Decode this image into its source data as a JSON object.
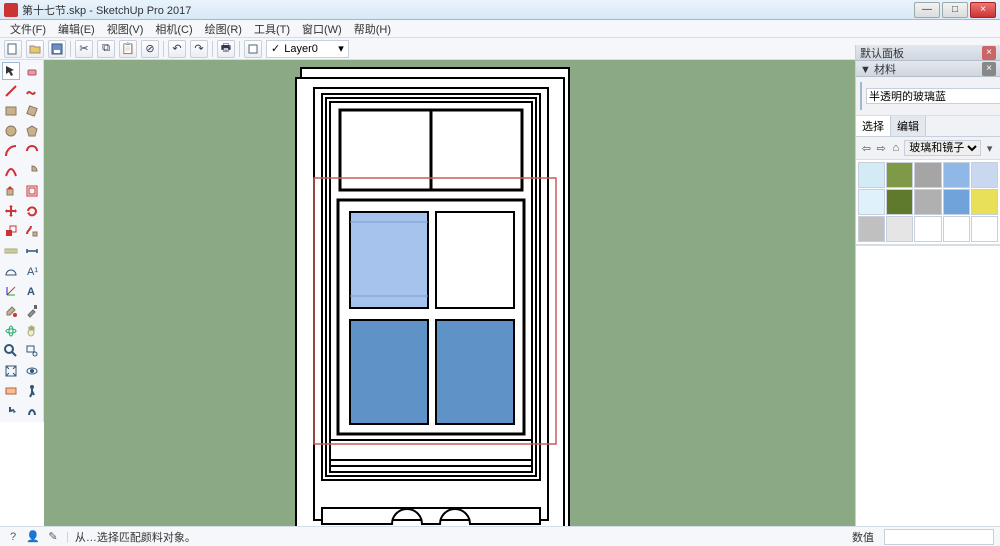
{
  "window": {
    "title": "第十七节.skp - SketchUp Pro 2017",
    "min": "—",
    "max": "□",
    "close": "×"
  },
  "menu": [
    "文件(F)",
    "编辑(E)",
    "视图(V)",
    "相机(C)",
    "绘图(R)",
    "工具(T)",
    "窗口(W)",
    "帮助(H)"
  ],
  "layer": {
    "label": "Layer0"
  },
  "status": {
    "hint": "从…选择匹配颜料对象。",
    "value_label": "数值"
  },
  "panel": {
    "default_tray": "默认面板",
    "materials": "▼ 材料",
    "mat_name": "半透明的玻璃蓝",
    "tab_select": "选择",
    "tab_edit": "编辑",
    "library": "玻璃和镜子"
  },
  "swatches": [
    "#d3ebf5",
    "#7f9a46",
    "#a5a5a5",
    "#8fb8e6",
    "#c9d8ef",
    "#dff1fa",
    "#5f7a2c",
    "#b0b0b0",
    "#6fa3d9",
    "#e9e05a",
    "#c0c0c0",
    "#e5e5e5",
    "#ffffff",
    "#ffffff",
    "#ffffff"
  ],
  "swatch_grid": {
    "cols": 5,
    "rows": 3
  },
  "tools_left_count": 36,
  "colors": {
    "viewport_bg": "#8aa984",
    "pane_light": "#a5c3ec",
    "pane_dark": "#5f93c7",
    "selection_box": "#c95b5b"
  }
}
